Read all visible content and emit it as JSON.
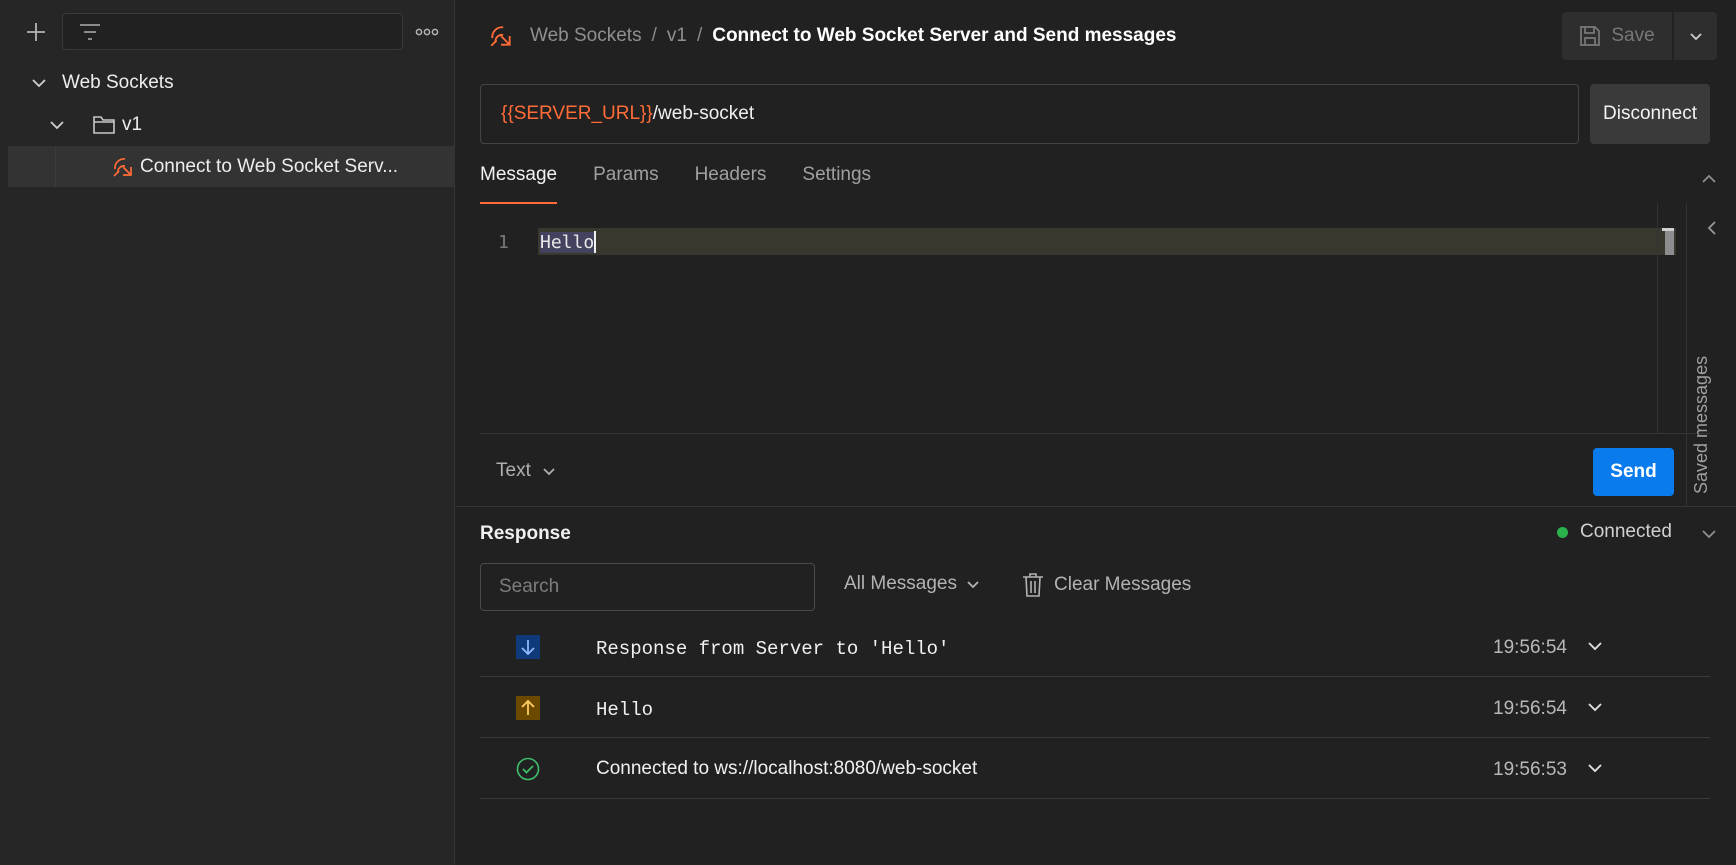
{
  "sidebar": {
    "tree": {
      "collection": "Web Sockets",
      "folder": "v1",
      "request": "Connect to Web Socket Serv..."
    }
  },
  "header": {
    "breadcrumb": [
      "Web Sockets",
      "v1",
      "Connect to Web Socket Server and Send messages"
    ],
    "separator": "/",
    "save_label": "Save"
  },
  "request": {
    "url_variable": "{{SERVER_URL}}",
    "url_path": "/web-socket",
    "disconnect_label": "Disconnect"
  },
  "tabs": [
    {
      "label": "Message",
      "active": true
    },
    {
      "label": "Params",
      "active": false
    },
    {
      "label": "Headers",
      "active": false
    },
    {
      "label": "Settings",
      "active": false
    }
  ],
  "editor": {
    "line_number": "1",
    "content": "Hello"
  },
  "saved_messages_label": "Saved messages",
  "composer": {
    "format": "Text",
    "send_label": "Send"
  },
  "response": {
    "title": "Response",
    "status": "Connected",
    "search_placeholder": "Search",
    "filter_label": "All Messages",
    "clear_label": "Clear Messages",
    "messages": [
      {
        "direction": "incoming",
        "text": "Response from Server to 'Hello'",
        "time": "19:56:54"
      },
      {
        "direction": "outgoing",
        "text": "Hello",
        "time": "19:56:54"
      },
      {
        "direction": "connected",
        "text": "Connected to ws://localhost:8080/web-socket",
        "time": "19:56:53"
      }
    ]
  },
  "colors": {
    "accent": "#ff6c37",
    "send": "#097bed",
    "connected": "#2bb24c",
    "incoming": "#0f3a7a",
    "outgoing": "#6b4a00"
  }
}
